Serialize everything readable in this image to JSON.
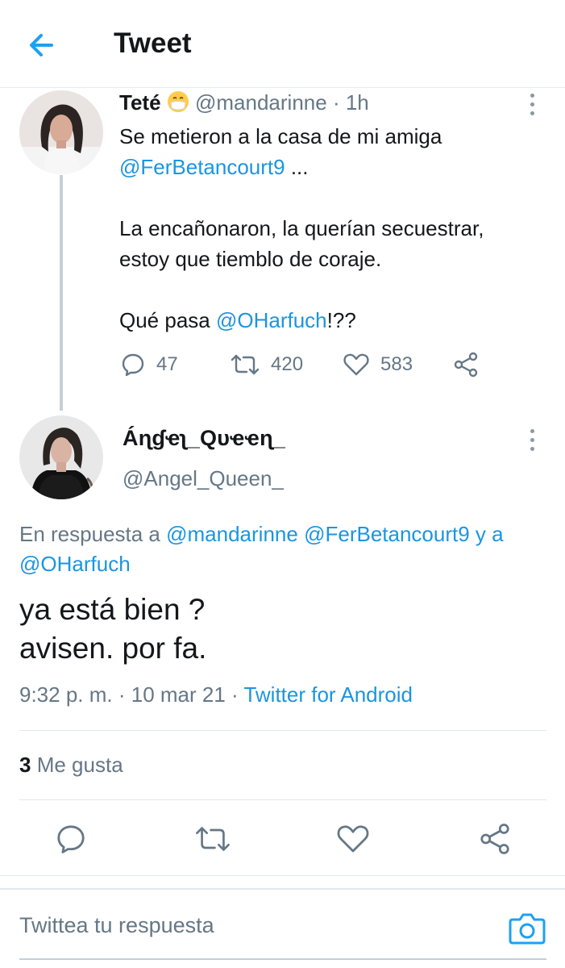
{
  "header": {
    "title": "Tweet"
  },
  "tweet1": {
    "name": "Teté",
    "emoji": "mask-face-emoji",
    "handle": "@mandarinne",
    "time": "· 1h",
    "text_1": "Se metieron a la casa de mi amiga",
    "mention_1": "@FerBetancourt9",
    "text_1b": " ...",
    "text_2": "La encañonaron, la querían secuestrar, estoy que tiemblo de coraje.",
    "text_3a": "Qué pasa ",
    "mention_2": "@OHarfuch",
    "text_3b": "!??",
    "replies": "47",
    "retweets": "420",
    "likes": "583"
  },
  "tweet2": {
    "name": "Áɳɠҽʅ_Qυҽҽɳ_",
    "handle": "@Angel_Queen_",
    "reply_prefix": "En respuesta a ",
    "reply_mention_1": "@mandarinne",
    "reply_mention_2": "@FerBetancourt9",
    "reply_joiner": " y a ",
    "reply_mention_3": "@OHarfuch",
    "text_line1": "ya está bien ?",
    "text_line2": "avisen. por fa.",
    "time": "9:32 p. m.",
    "date": "· 10 mar 21 ·",
    "source": "Twitter for Android",
    "like_count": "3",
    "like_label": "Me gusta"
  },
  "composer": {
    "placeholder": "Twittea tu respuesta"
  },
  "colors": {
    "accent": "#1b95e0",
    "muted": "#657786",
    "text": "#14171a",
    "divider": "#e1e8ed"
  }
}
